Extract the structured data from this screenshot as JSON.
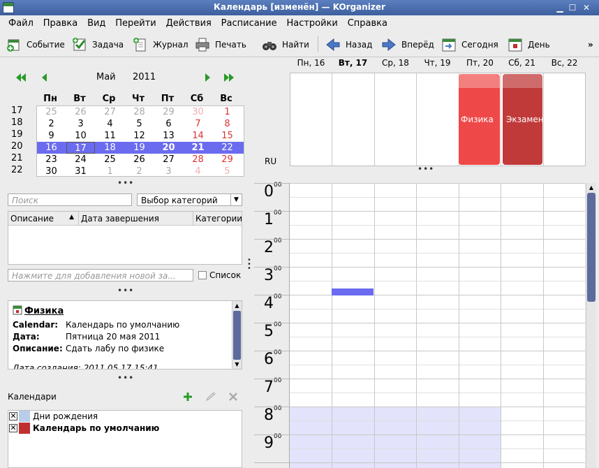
{
  "window": {
    "title": "Календарь [изменён] — KOrganizer"
  },
  "menu": [
    "Файл",
    "Правка",
    "Вид",
    "Перейти",
    "Действия",
    "Расписание",
    "Настройки",
    "Справка"
  ],
  "toolbar": {
    "event": "Событие",
    "todo": "Задача",
    "journal": "Журнал",
    "print": "Печать",
    "find": "Найти",
    "back": "Назад",
    "forward": "Вперёд",
    "today": "Сегодня",
    "day": "День",
    "more": "»"
  },
  "datenav": {
    "month": "Май",
    "year": "2011",
    "weekdays": [
      "Пн",
      "Вт",
      "Ср",
      "Чт",
      "Пт",
      "Сб",
      "Вс"
    ],
    "weeks": [
      {
        "num": "17",
        "days": [
          "25",
          "26",
          "27",
          "28",
          "29",
          "30",
          "1"
        ]
      },
      {
        "num": "18",
        "days": [
          "2",
          "3",
          "4",
          "5",
          "6",
          "7",
          "8"
        ]
      },
      {
        "num": "19",
        "days": [
          "9",
          "10",
          "11",
          "12",
          "13",
          "14",
          "15"
        ]
      },
      {
        "num": "20",
        "days": [
          "16",
          "17",
          "18",
          "19",
          "20",
          "21",
          "22"
        ]
      },
      {
        "num": "21",
        "days": [
          "23",
          "24",
          "25",
          "26",
          "27",
          "28",
          "29"
        ]
      },
      {
        "num": "22",
        "days": [
          "30",
          "31",
          "1",
          "2",
          "3",
          "4",
          "5"
        ]
      }
    ]
  },
  "todo": {
    "search_placeholder": "Поиск",
    "category": "Выбор категорий",
    "columns": [
      "Описание",
      "Дата завершения",
      "Категории"
    ],
    "new_placeholder": "Нажмите для добавления новой за...",
    "list_label": "Список"
  },
  "incidence": {
    "title": "Физика",
    "calendar_label": "Calendar:",
    "calendar_value": "Календарь по умолчанию",
    "date_label": "Дата:",
    "date_value": "Пятница 20 мая 2011",
    "desc_label": "Описание:",
    "desc_value": "Сдать лабу по физике",
    "created": "Дата создания: 2011.05.17 15:41"
  },
  "calendars": {
    "title": "Календари",
    "items": [
      {
        "name": "Дни рождения",
        "color": "#b8cde8",
        "checked": "✕"
      },
      {
        "name": "Календарь по умолчанию",
        "color": "#c03030",
        "checked": "✕"
      }
    ]
  },
  "agenda": {
    "days": [
      "Пн, 16",
      "Вт, 17",
      "Ср, 18",
      "Чт, 19",
      "Пт, 20",
      "Сб, 21",
      "Вс, 22"
    ],
    "timezone": "RU",
    "allday_events": [
      {
        "title": "Физика",
        "color": "#ee4848"
      },
      {
        "title": "Экзамен",
        "color": "#c03a3a"
      }
    ],
    "hours": [
      "0",
      "1",
      "2",
      "3",
      "4",
      "5",
      "6",
      "7",
      "8",
      "9"
    ],
    "minutes": "00"
  },
  "colors": {
    "accent": "#6b6bf0",
    "title_bar": "#4a6bab",
    "work_hours": "#e3e3fb"
  }
}
